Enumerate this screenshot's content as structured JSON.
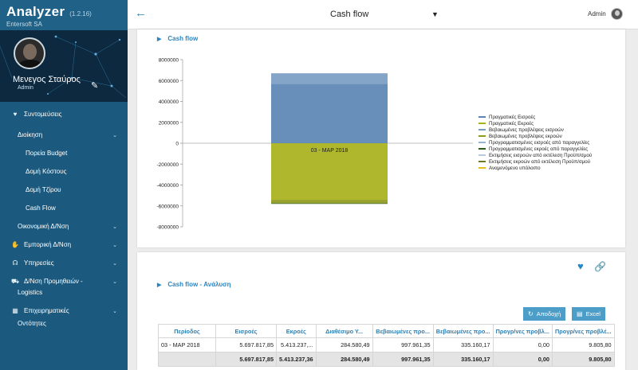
{
  "app": {
    "name": "Analyzer",
    "version": "(1.2.16)",
    "company": "Entersoft SA"
  },
  "user": {
    "name": "Μενεγος Σταύρος",
    "role": "Admin"
  },
  "menu": [
    {
      "label": "Συντομεύσεις",
      "icon": "heart-icon",
      "level": 0,
      "chevron": false
    },
    {
      "label": "Διοίκηση",
      "icon": "",
      "level": 1,
      "chevron": true
    },
    {
      "label": "Πορεία Budget",
      "icon": "",
      "level": 2,
      "chevron": false
    },
    {
      "label": "Δομή Κόστους",
      "icon": "",
      "level": 2,
      "chevron": false
    },
    {
      "label": "Δομή Τζίρου",
      "icon": "",
      "level": 2,
      "chevron": false
    },
    {
      "label": "Cash Flow",
      "icon": "",
      "level": 2,
      "chevron": false
    },
    {
      "label": "Οικονομική Δ/Νση",
      "icon": "",
      "level": 1,
      "chevron": true
    },
    {
      "label": "Εμπορική Δ/Νση",
      "icon": "handshake-icon",
      "level": 0,
      "chevron": true
    },
    {
      "label": "Υπηρεσίες",
      "icon": "headset-icon",
      "level": 0,
      "chevron": true
    },
    {
      "label": "Δ/Νση Προμηθειών -",
      "icon": "truck-icon",
      "level": 0,
      "chevron": true
    },
    {
      "label": "Logistics",
      "icon": "",
      "level": 1,
      "chevron": false
    },
    {
      "label": "Επιχειρηματικές",
      "icon": "building-icon",
      "level": 0,
      "chevron": true
    },
    {
      "label": "Οντότητες",
      "icon": "",
      "level": 1,
      "chevron": false
    }
  ],
  "topbar": {
    "page": "Cash flow",
    "user": "Admin"
  },
  "card1": {
    "title": "Cash flow"
  },
  "card2": {
    "title": "Cash flow - Ανάλυση",
    "btn_accept": "Αποδοχή",
    "btn_excel": "Excel"
  },
  "colors": {
    "accent": "#2a86c2",
    "sidebar": "#1b5a7e",
    "inflow_bar": "#7a9cc3",
    "outflow_bar": "#b5bd2b"
  },
  "chart_data": {
    "type": "bar",
    "stacked": true,
    "categories": [
      "03 - ΜΑΡ 2018"
    ],
    "ylim": [
      -8000000,
      8000000
    ],
    "yticks": [
      8000000,
      6000000,
      4000000,
      2000000,
      0,
      -2000000,
      -4000000,
      -6000000,
      -8000000
    ],
    "series": [
      {
        "name": "Πραγματικές Εισροές",
        "color": "#5b86b4",
        "values": [
          5697817.85
        ]
      },
      {
        "name": "Πραγματικές Εκροές",
        "color": "#a8b21a",
        "values": [
          -5413237.36
        ]
      },
      {
        "name": "Βεβαιωμένες προβλέψεις εισροών",
        "color": "#7a9cc3",
        "values": [
          997961.35
        ]
      },
      {
        "name": "Βεβαιωμένες προβλέψεις εκροών",
        "color": "#8e9a1a",
        "values": [
          -335160.17
        ]
      },
      {
        "name": "Προγραμματισμένες εισροές από παραγγελίες",
        "color": "#9ab3d3",
        "values": [
          0
        ]
      },
      {
        "name": "Προγραμματισμένες εκροές από παραγγελίες",
        "color": "#2d5e1c",
        "values": [
          -9805.8
        ]
      },
      {
        "name": "Εκτιμήσεις εισροών από εκτέλεση Προϋπ/σμού",
        "color": "#b9c8dc",
        "values": [
          0
        ]
      },
      {
        "name": "Εκτιμήσεις εκροών από εκτέλεση Προϋπ/σμού",
        "color": "#6a7a22",
        "values": [
          0
        ]
      },
      {
        "name": "Αναμενόμενο υπόλοιπο",
        "color": "#e0c020",
        "values": [
          0
        ]
      }
    ],
    "legend": "right",
    "grid": false
  },
  "table": {
    "columns": [
      "Περίοδος",
      "Εισροές",
      "Εκροές",
      "Διαθέσιμο Υ...",
      "Βεβαιωμένες προ...",
      "Βεβαιωμένες προ...",
      "Προγρ/νες προβλ...",
      "Προγρ/νες προβλέ..."
    ],
    "rows": [
      [
        "03 - ΜΑΡ 2018",
        "5.697.817,85",
        "5.413.237,...",
        "284.580,49",
        "997.961,35",
        "335.160,17",
        "0,00",
        "9.805,80"
      ]
    ],
    "total": [
      "",
      "5.697.817,85",
      "5.413.237,36",
      "284.580,49",
      "997.961,35",
      "335.160,17",
      "0,00",
      "9.805,80"
    ]
  }
}
